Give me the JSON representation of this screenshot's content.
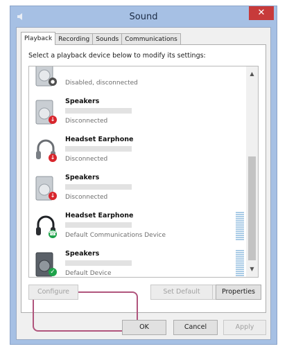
{
  "window": {
    "title": "Sound",
    "close_glyph": "✕"
  },
  "tabs": [
    {
      "label": "Playback",
      "active": true
    },
    {
      "label": "Recording",
      "active": false
    },
    {
      "label": "Sounds",
      "active": false
    },
    {
      "label": "Communications",
      "active": false
    }
  ],
  "instruction": "Select a playback device below to modify its settings:",
  "devices": [
    {
      "name": "",
      "status": "Disabled, disconnected",
      "icon": "speaker-icon",
      "badge": "disabled-badge-icon"
    },
    {
      "name": "Speakers",
      "status": "Disconnected",
      "icon": "speaker-icon",
      "badge": "disconnected-badge-icon"
    },
    {
      "name": "Headset Earphone",
      "status": "Disconnected",
      "icon": "headset-icon",
      "badge": "disconnected-badge-icon"
    },
    {
      "name": "Speakers",
      "status": "Disconnected",
      "icon": "speaker-icon",
      "badge": "disconnected-badge-icon"
    },
    {
      "name": "Headset Earphone",
      "status": "Default Communications Device",
      "icon": "headset-icon",
      "badge": "phone-badge-icon"
    },
    {
      "name": "Speakers",
      "status": "Default Device",
      "icon": "speaker-icon",
      "badge": "check-badge-icon"
    }
  ],
  "buttons": {
    "configure": "Configure",
    "set_default": "Set Default",
    "properties": "Properties",
    "ok": "OK",
    "cancel": "Cancel",
    "apply": "Apply"
  },
  "colors": {
    "title_bar": "#a6c0e4",
    "close_button": "#c73a3a",
    "highlight_outline": "#b0547c",
    "status_disconnected": "#d8262d",
    "status_default": "#1ea34a"
  }
}
